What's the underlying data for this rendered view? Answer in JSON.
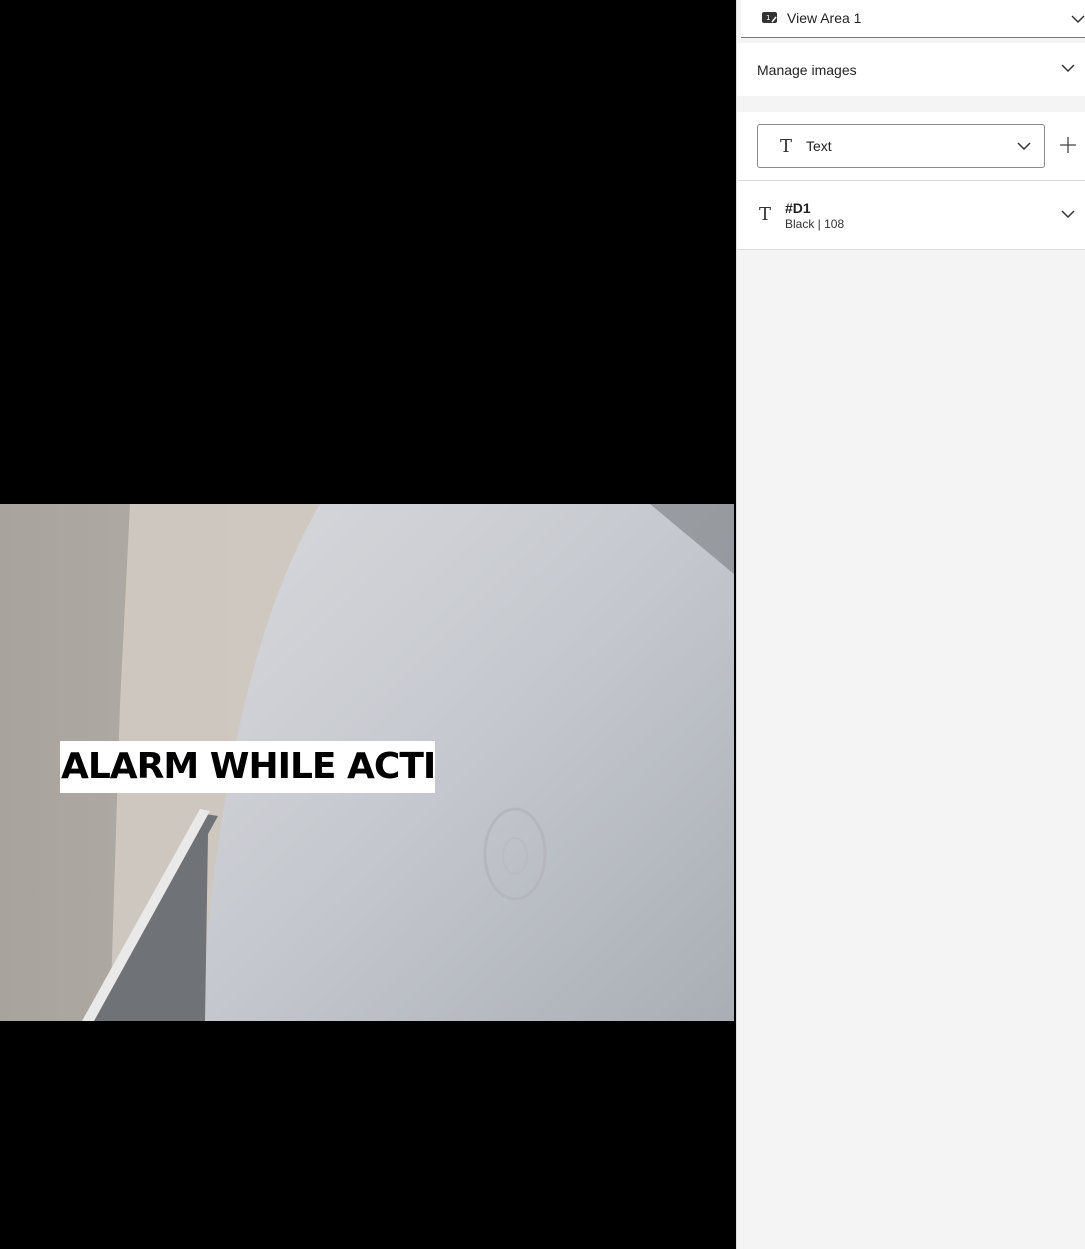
{
  "viewer": {
    "overlay_text": "ALARM WHILE ACTIVE"
  },
  "panel": {
    "view_area": {
      "label": "View Area 1",
      "icon": "view-area-icon"
    },
    "manage_images": {
      "label": "Manage images"
    },
    "overlay_type": {
      "label": "Text",
      "icon": "text-t-icon"
    },
    "overlays": [
      {
        "title": "#D1",
        "subtitle": "Black | 108",
        "icon": "text-t-icon"
      }
    ]
  }
}
